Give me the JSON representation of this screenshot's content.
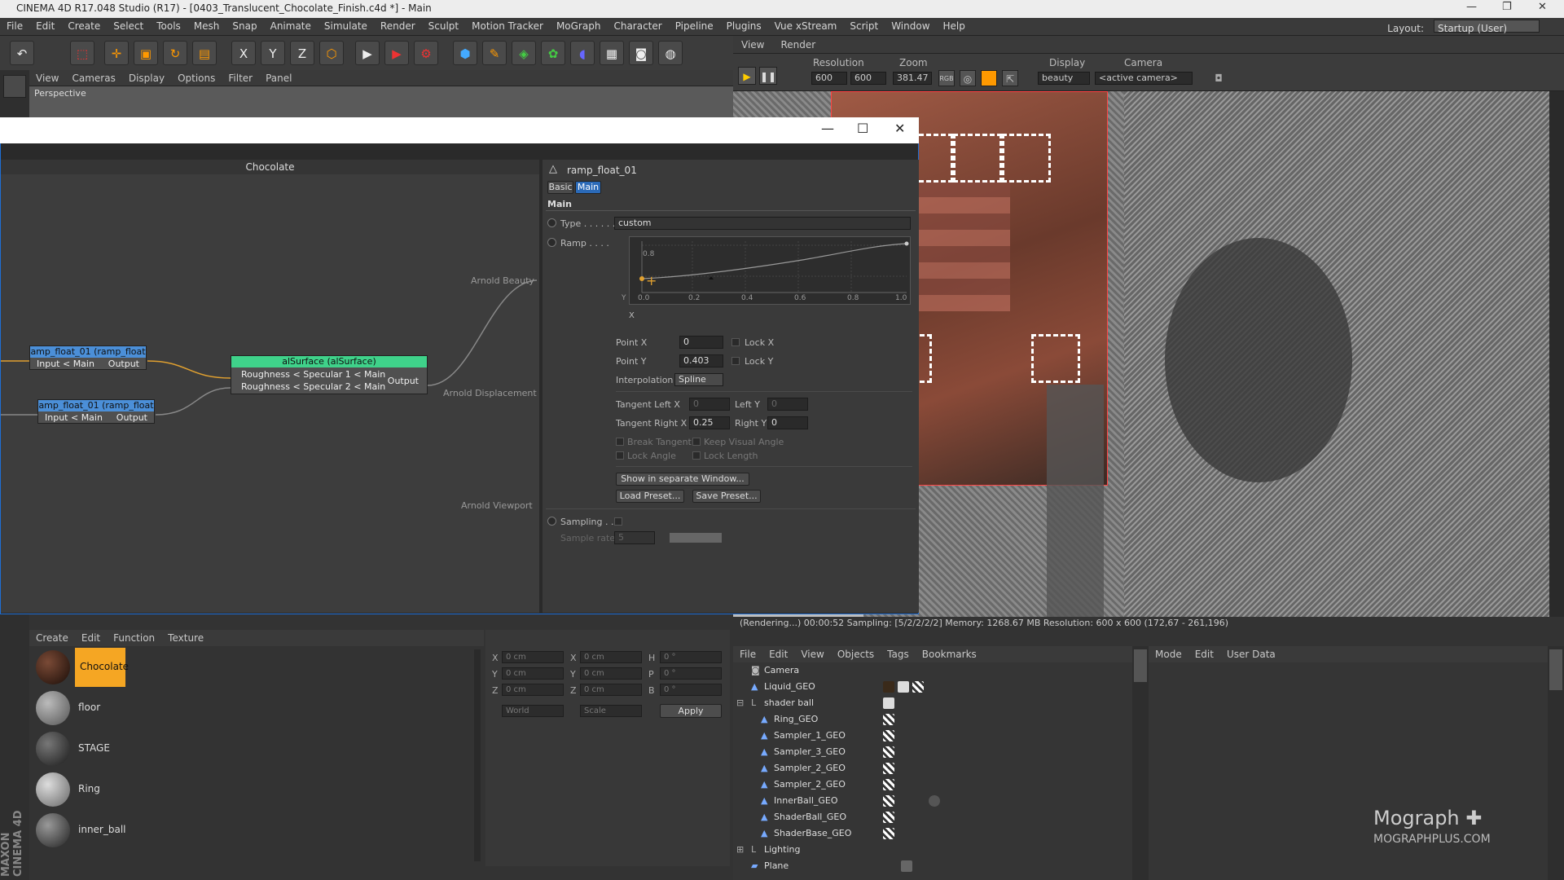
{
  "window": {
    "title": "CINEMA 4D R17.048 Studio (R17) - [0403_Translucent_Chocolate_Finish.c4d *] - Main"
  },
  "menu": [
    "File",
    "Edit",
    "Create",
    "Select",
    "Tools",
    "Mesh",
    "Snap",
    "Animate",
    "Simulate",
    "Render",
    "Sculpt",
    "Motion Tracker",
    "MoGraph",
    "Character",
    "Pipeline",
    "Plugins",
    "Vue xStream",
    "Script",
    "Window",
    "Help"
  ],
  "layout": {
    "label": "Layout:",
    "value": "Startup (User)"
  },
  "viewport": {
    "menu": [
      "View",
      "Cameras",
      "Display",
      "Options",
      "Filter",
      "Panel"
    ],
    "label": "Perspective"
  },
  "render_view": {
    "menu": [
      "View",
      "Render"
    ],
    "resolution_label": "Resolution",
    "res_w": "600",
    "res_h": "600",
    "zoom_label": "Zoom",
    "zoom": "381.47",
    "display_label": "Display",
    "display": "beauty",
    "camera_label": "Camera",
    "camera": "<active camera>",
    "status": "(Rendering...)  00:00:52  Sampling: [5/2/2/2/2]  Memory: 1268.67 MB  Resolution: 600 x 600 (172,67 - 261,196)"
  },
  "node_editor": {
    "title": "Chocolate",
    "nodes": [
      {
        "title": "amp_float_01 (ramp_float",
        "in": "Input < Main",
        "out": "Output"
      },
      {
        "title": "amp_float_01 (ramp_float",
        "in": "Input < Main",
        "out": "Output"
      },
      {
        "title": "alSurface (alSurface)",
        "in1": "Roughness < Specular 1 < Main",
        "in2": "Roughness < Specular 2 < Main",
        "out": "Output"
      }
    ],
    "ports": [
      "Arnold Beauty",
      "Arnold Displacement",
      "Arnold Viewport"
    ]
  },
  "attributes": {
    "node_name": "ramp_float_01",
    "tabs": [
      "Basic",
      "Main"
    ],
    "section": "Main",
    "type_label": "Type . . . . . .",
    "type_value": "custom",
    "ramp_label": "Ramp . . . .",
    "ramp_ticks": [
      "0.0",
      "0.2",
      "0.4",
      "0.6",
      "0.8",
      "1.0"
    ],
    "ramp_y_tick": "0.8",
    "axis_x": "X",
    "axis_y": "Y",
    "point_x_label": "Point X",
    "point_x": "0",
    "point_y_label": "Point Y",
    "point_y": "0.403",
    "lock_x": "Lock X",
    "lock_y": "Lock Y",
    "interp_label": "Interpolation",
    "interp_value": "Spline",
    "tan_left_x_label": "Tangent Left X",
    "tan_left_x": "0",
    "left_y_label": "Left Y",
    "left_y": "0",
    "tan_right_x_label": "Tangent Right X",
    "tan_right_x": "0.25",
    "right_y_label": "Right Y",
    "right_y": "0",
    "break_tangent": "Break Tangent",
    "keep_visual": "Keep Visual Angle",
    "lock_angle": "Lock Angle",
    "lock_length": "Lock Length",
    "show_separate": "Show in separate Window...",
    "load_preset": "Load Preset...",
    "save_preset": "Save Preset...",
    "sampling_label": "Sampling . .",
    "sample_rate_label": "Sample rate",
    "sample_rate": "5"
  },
  "materials": {
    "menu": [
      "Create",
      "Edit",
      "Function",
      "Texture"
    ],
    "items": [
      {
        "name": "Chocolate",
        "color": "#2a1a12"
      },
      {
        "name": "floor",
        "color": "#7a7a7a"
      },
      {
        "name": "STAGE",
        "color": "#3a3a3a"
      },
      {
        "name": "Ring",
        "color": "#9a9a9a"
      },
      {
        "name": "inner_ball",
        "color": "#555555"
      }
    ]
  },
  "coords": {
    "labels": [
      "X",
      "Y",
      "Z",
      "X",
      "Y",
      "Z",
      "H",
      "P",
      "B"
    ],
    "value_cm": "0 cm",
    "value_deg": "0 °",
    "world": "World",
    "scale": "Scale",
    "apply": "Apply"
  },
  "objects": {
    "menu": [
      "File",
      "Edit",
      "View",
      "Objects",
      "Tags",
      "Bookmarks"
    ],
    "items": [
      "Camera",
      "Liquid_GEO",
      "shader ball",
      "Ring_GEO",
      "Sampler_1_GEO",
      "Sampler_3_GEO",
      "Sampler_2_GEO",
      "Sampler_2_GEO",
      "InnerBall_GEO",
      "ShaderBall_GEO",
      "ShaderBase_GEO",
      "Lighting",
      "Plane"
    ]
  },
  "attr_manager": {
    "menu": [
      "Mode",
      "Edit",
      "User Data"
    ]
  },
  "watermark": {
    "brand": "Mograph",
    "site": "MOGRAPHPLUS.COM"
  },
  "vertical_brand": "MAXON CINEMA 4D"
}
